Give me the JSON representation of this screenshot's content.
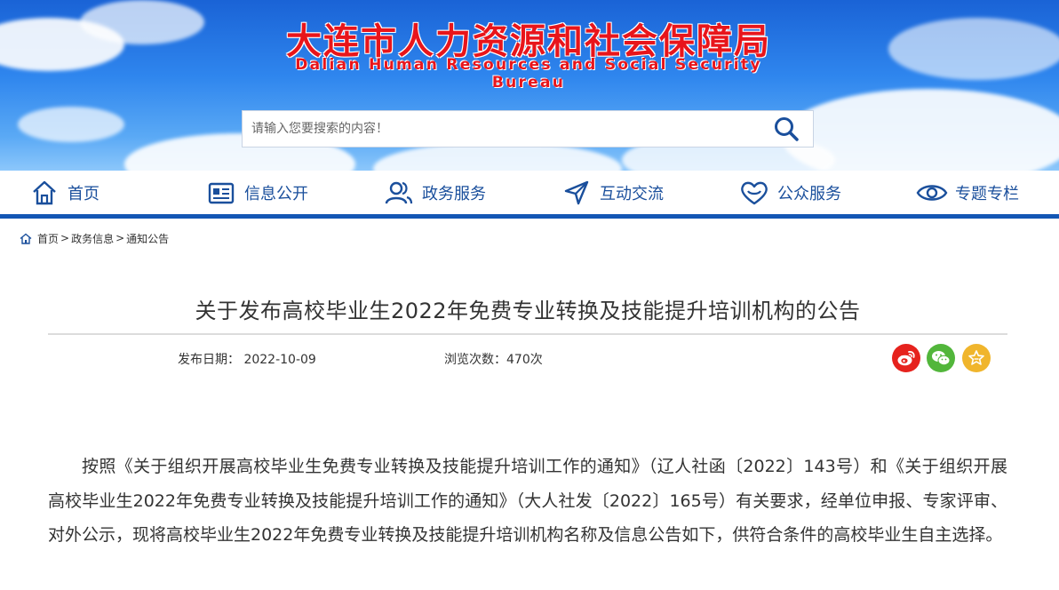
{
  "header": {
    "title": "大连市人力资源和社会保障局",
    "subtitle": "Dalian Human Resources and Social Security Bureau",
    "search_placeholder": "请输入您要搜索的内容！"
  },
  "nav": {
    "items": [
      {
        "label": "首页",
        "icon": "home-icon"
      },
      {
        "label": "信息公开",
        "icon": "news-icon"
      },
      {
        "label": "政务服务",
        "icon": "users-icon"
      },
      {
        "label": "互动交流",
        "icon": "send-icon"
      },
      {
        "label": "公众服务",
        "icon": "heart-icon"
      },
      {
        "label": "专题专栏",
        "icon": "eye-icon"
      }
    ]
  },
  "breadcrumb": {
    "items": [
      "首页",
      "政务信息",
      "通知公告"
    ],
    "separator": ">"
  },
  "article": {
    "title": "关于发布高校毕业生2022年免费专业转换及技能提升培训机构的公告",
    "date_label": "发布日期：",
    "date": "2022-10-09",
    "views_label": "浏览次数：",
    "views": "470次",
    "body": "按照《关于组织开展高校毕业生免费专业转换及技能提升培训工作的通知》（辽人社函〔2022〕143号）和《关于组织开展高校毕业生2022年免费专业转换及技能提升培训工作的通知》（大人社发〔2022〕165号）有关要求，经单位申报、专家评审、对外公示，现将高校毕业生2022年免费专业转换及技能提升培训机构名称及信息公告如下，供符合条件的高校毕业生自主选择。"
  },
  "share": {
    "icons": [
      "weibo-icon",
      "wechat-icon",
      "favorite-icon"
    ],
    "colors": {
      "weibo": "#e6221d",
      "wechat": "#52b63b",
      "favorite": "#f0b52c"
    }
  },
  "colors": {
    "title_red": "#e8151b",
    "nav_text": "#1a4f9c",
    "nav_border": "#1356b4"
  }
}
